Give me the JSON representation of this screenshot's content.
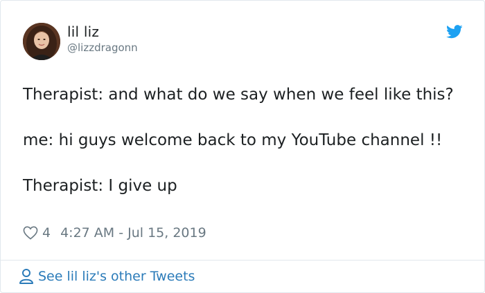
{
  "tweet": {
    "author": {
      "name": "lil liz",
      "handle": "@lizzdragonn"
    },
    "text": {
      "line1": "Therapist: and what do we say when we feel like this?",
      "line2": "me: hi guys welcome back to my YouTube channel !!",
      "line3": "Therapist: I give up"
    },
    "likes": "4",
    "timestamp": "4:27 AM - Jul 15, 2019",
    "footer_link": "See lil liz's other Tweets"
  },
  "icons": {
    "brand": "twitter-bird-icon",
    "like": "heart-icon",
    "profile": "person-icon"
  },
  "colors": {
    "brand_blue": "#1da1f2",
    "link_blue": "#2b7bb9",
    "muted_gray": "#697882",
    "text": "#1c2022",
    "border": "#e1e8ed"
  }
}
